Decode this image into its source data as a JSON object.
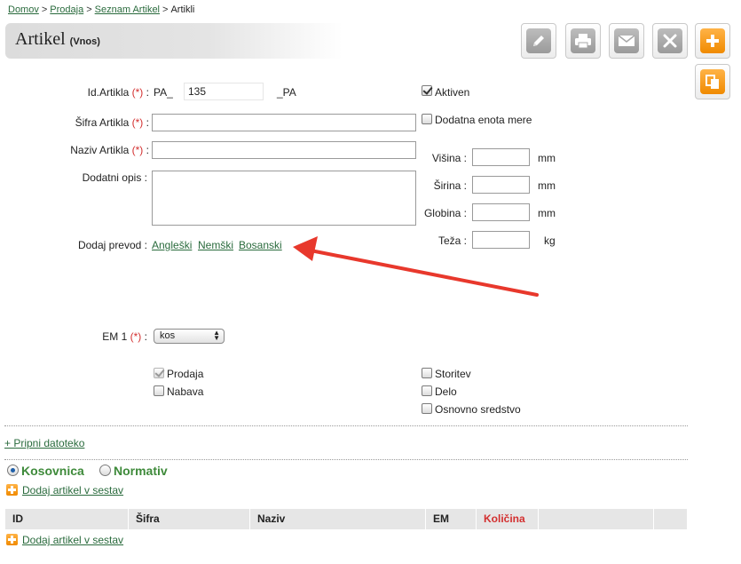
{
  "breadcrumb": {
    "items": [
      "Domov",
      "Prodaja",
      "Seznam Artikel"
    ],
    "current": "Artikli"
  },
  "header": {
    "title": "Artikel",
    "subtitle": "(Vnos)"
  },
  "form": {
    "id_label": "Id.Artikla",
    "required_mark": "(*)",
    "colon": ":",
    "id_prefix": "PA_",
    "id_value": "135",
    "id_suffix": "_PA",
    "sifra_label": "Šifra Artikla",
    "sifra_value": "",
    "naziv_label": "Naziv Artikla",
    "naziv_value": "",
    "opis_label": "Dodatni opis :",
    "opis_value": "",
    "prevod_label": "Dodaj prevod :",
    "prevod_links": [
      "Angleški",
      "Nemški",
      "Bosanski"
    ],
    "em_label": "EM 1",
    "em_value": "kos"
  },
  "right_panel": {
    "aktiven": {
      "label": "Aktiven",
      "checked": true
    },
    "dodatna": {
      "label": "Dodatna enota mere",
      "checked": false
    },
    "dimensions": [
      {
        "label": "Višina :",
        "value": "",
        "unit": "mm"
      },
      {
        "label": "Širina :",
        "value": "",
        "unit": "mm"
      },
      {
        "label": "Globina :",
        "value": "",
        "unit": "mm"
      },
      {
        "label": "Teža :",
        "value": "",
        "unit": "kg"
      }
    ]
  },
  "checkboxes": {
    "prodaja": {
      "label": "Prodaja",
      "checked": true,
      "disabled": true
    },
    "nabava": {
      "label": "Nabava",
      "checked": false
    },
    "storitev": {
      "label": "Storitev",
      "checked": false
    },
    "delo": {
      "label": "Delo",
      "checked": false
    },
    "osnovno": {
      "label": "Osnovno sredstvo",
      "checked": false
    }
  },
  "attach_link": "+ Pripni datoteko",
  "radios": {
    "kosovnica": "Kosovnica",
    "normativ": "Normativ",
    "selected": "kosovnica"
  },
  "add_link": "Dodaj artikel v sestav",
  "table": {
    "columns": [
      "ID",
      "Šifra",
      "Naziv",
      "EM",
      "Količina",
      "",
      ""
    ]
  },
  "colors": {
    "link": "#2a6b3d",
    "required": "#d32f2f",
    "accent_orange": "#f08a00",
    "radio_text": "#3e8a3a",
    "arrow": "#e8382c"
  }
}
